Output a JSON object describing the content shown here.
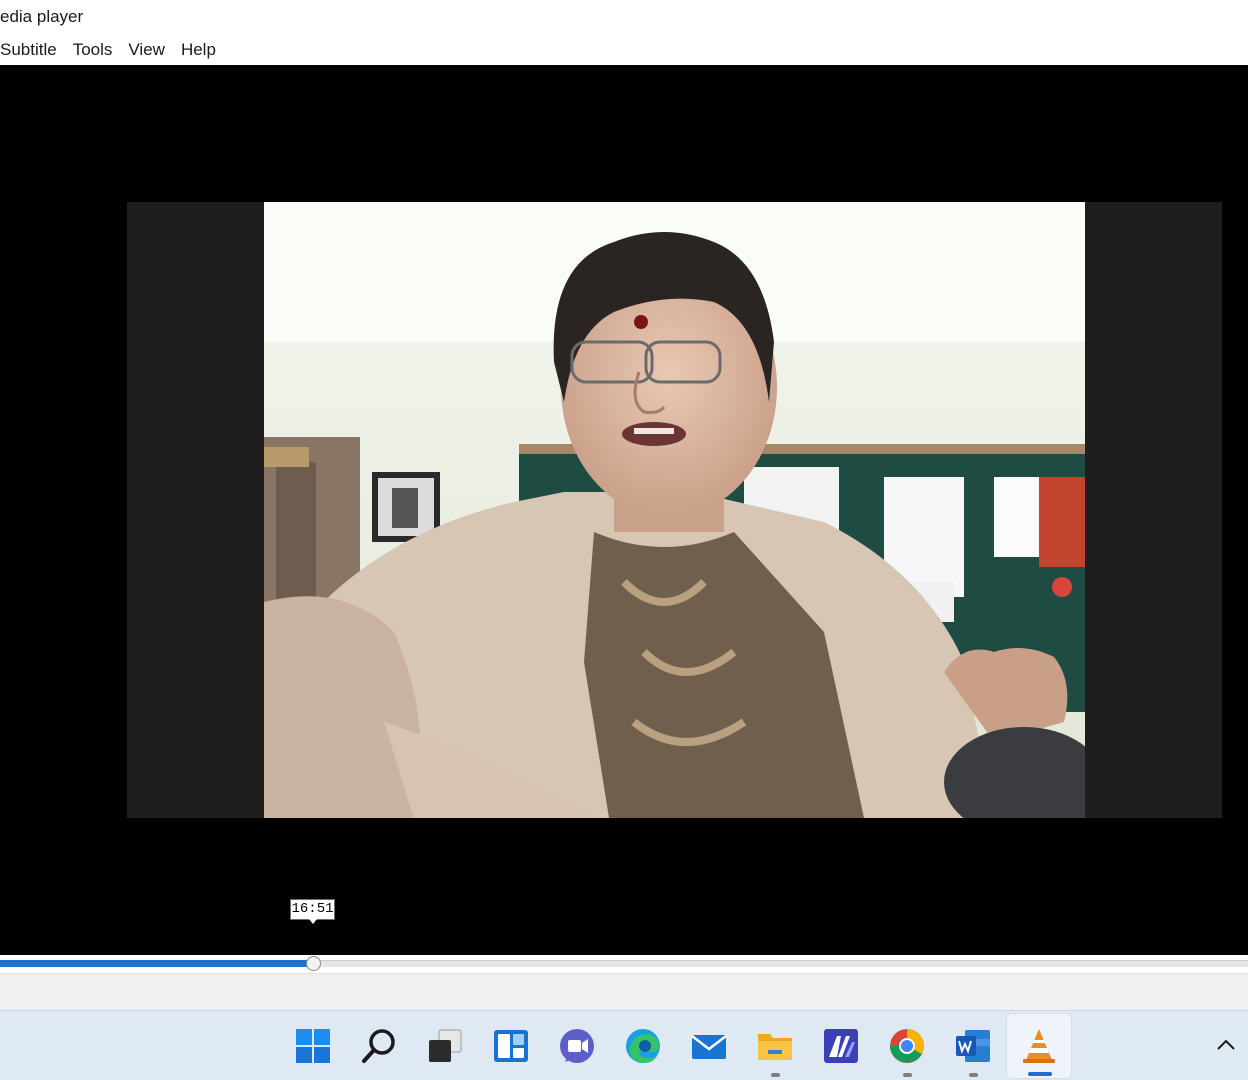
{
  "window": {
    "title": "edia player"
  },
  "menu": {
    "items": [
      "Subtitle",
      "Tools",
      "View",
      "Help"
    ]
  },
  "player": {
    "time_tooltip": "16:51",
    "progress": 0.252
  },
  "taskbar": {
    "icons": [
      {
        "name": "windows-start-icon",
        "running": false,
        "active": false
      },
      {
        "name": "search-icon",
        "running": false,
        "active": false
      },
      {
        "name": "task-view-icon",
        "running": false,
        "active": false
      },
      {
        "name": "widgets-icon",
        "running": false,
        "active": false
      },
      {
        "name": "teams-chat-icon",
        "running": false,
        "active": false
      },
      {
        "name": "edge-browser-icon",
        "running": false,
        "active": false
      },
      {
        "name": "mail-icon",
        "running": false,
        "active": false
      },
      {
        "name": "file-explorer-icon",
        "running": true,
        "active": false
      },
      {
        "name": "app-m-icon",
        "running": false,
        "active": false
      },
      {
        "name": "chrome-icon",
        "running": true,
        "active": false
      },
      {
        "name": "word-icon",
        "running": true,
        "active": false
      },
      {
        "name": "vlc-icon",
        "running": true,
        "active": true
      }
    ],
    "tray": {
      "chevron_icon": "chevron-up-icon"
    }
  },
  "colors": {
    "accent": "#1f73cf",
    "video_background": "#000000",
    "taskbar": "#dfe9f3"
  }
}
